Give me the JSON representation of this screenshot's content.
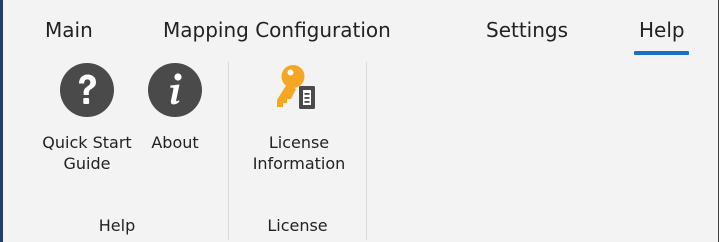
{
  "tabs": [
    {
      "label": "Main"
    },
    {
      "label": "Mapping Configuration"
    },
    {
      "label": "Settings"
    },
    {
      "label": "Help",
      "active": true
    }
  ],
  "ribbon": {
    "groups": [
      {
        "label": "Help",
        "buttons": [
          {
            "label_line1": "Quick Start",
            "label_line2": "Guide",
            "icon": "question-circle-icon"
          },
          {
            "label_line1": "About",
            "label_line2": "",
            "icon": "info-circle-icon"
          }
        ]
      },
      {
        "label": "License",
        "buttons": [
          {
            "label_line1": "License",
            "label_line2": "Information",
            "icon": "key-document-icon"
          }
        ]
      }
    ]
  },
  "colors": {
    "accent": "#1a6fc4",
    "icon_dark": "#4a4a4a",
    "key_orange": "#f5a623"
  }
}
